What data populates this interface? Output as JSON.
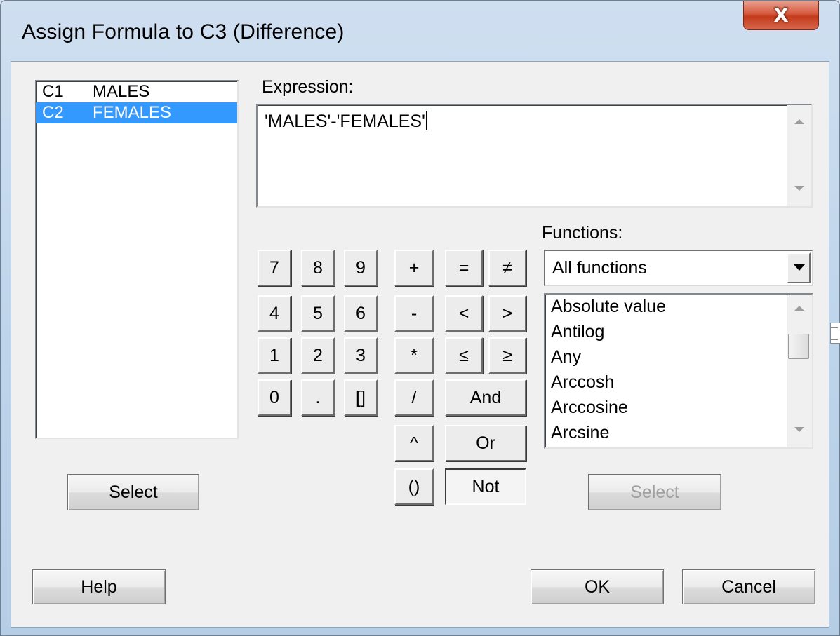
{
  "window": {
    "title": "Assign Formula to C3 (Difference)",
    "close_label": "X"
  },
  "variables": [
    {
      "col": "C1",
      "name": "MALES",
      "selected": false
    },
    {
      "col": "C2",
      "name": "FEMALES",
      "selected": true
    }
  ],
  "expression": {
    "label": "Expression:",
    "value": "'MALES'-'FEMALES'"
  },
  "keypad": {
    "digits": [
      "7",
      "8",
      "9",
      "4",
      "5",
      "6",
      "1",
      "2",
      "3",
      "0",
      ".",
      "[]"
    ],
    "operators": [
      "+",
      "-",
      "*",
      "/",
      "^",
      "()"
    ],
    "comparisons": [
      "=",
      "≠",
      "<",
      ">",
      "≤",
      "≥"
    ],
    "logic": [
      "And",
      "Or",
      "Not"
    ]
  },
  "functions": {
    "label": "Functions:",
    "filter": "All functions",
    "items": [
      "Absolute value",
      "Antilog",
      "Any",
      "Arccosh",
      "Arccosine",
      "Arcsine"
    ],
    "select_label": "Select"
  },
  "buttons": {
    "select": "Select",
    "help": "Help",
    "ok": "OK",
    "cancel": "Cancel"
  },
  "icons": {
    "close": "close-icon",
    "dropdown": "chevron-down-icon",
    "scroll_up": "scroll-up-arrow-icon",
    "scroll_down": "scroll-down-arrow-icon"
  }
}
